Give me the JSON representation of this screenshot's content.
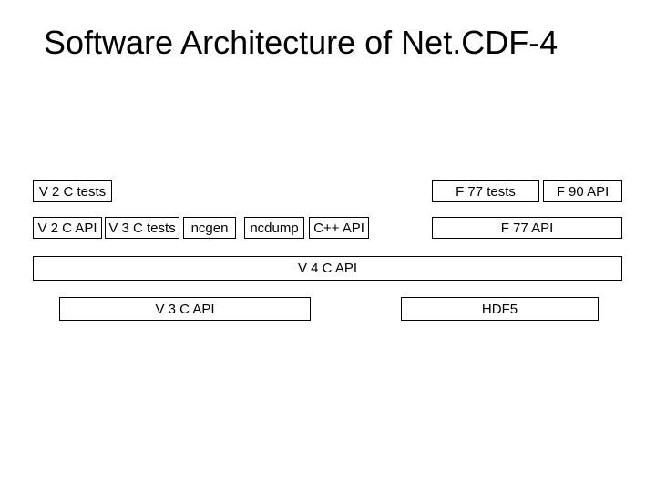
{
  "title": "Software Architecture of Net.CDF-4",
  "boxes": {
    "v2_c_tests": "V 2 C tests",
    "f77_tests": "F 77 tests",
    "f90_api": "F 90 API",
    "v2_c_api": "V 2 C API",
    "v3_c_tests": "V 3 C tests",
    "ncgen": "ncgen",
    "ncdump": "ncdump",
    "cpp_api": "C++ API",
    "f77_api": "F 77 API",
    "v4_c_api": "V 4 C API",
    "v3_c_api": "V 3 C API",
    "hdf5": "HDF5"
  }
}
